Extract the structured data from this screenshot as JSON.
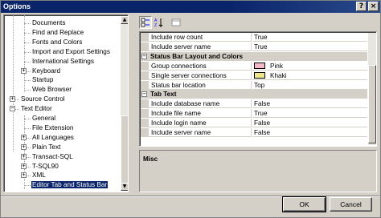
{
  "window": {
    "title": "Options",
    "help_label": "?",
    "close_label": "×"
  },
  "tree": {
    "items": [
      {
        "label": "Documents",
        "level": 2
      },
      {
        "label": "Find and Replace",
        "level": 2
      },
      {
        "label": "Fonts and Colors",
        "level": 2
      },
      {
        "label": "Import and Export Settings",
        "level": 2
      },
      {
        "label": "International Settings",
        "level": 2
      },
      {
        "label": "Keyboard",
        "level": 2,
        "expander": "+"
      },
      {
        "label": "Startup",
        "level": 2
      },
      {
        "label": "Web Browser",
        "level": 2
      },
      {
        "label": "Source Control",
        "level": 1,
        "expander": "+"
      },
      {
        "label": "Text Editor",
        "level": 1,
        "expander": "−"
      },
      {
        "label": "General",
        "level": 2
      },
      {
        "label": "File Extension",
        "level": 2
      },
      {
        "label": "All Languages",
        "level": 2,
        "expander": "+"
      },
      {
        "label": "Plain Text",
        "level": 2,
        "expander": "+"
      },
      {
        "label": "Transact-SQL",
        "level": 2,
        "expander": "+"
      },
      {
        "label": "T-SQL90",
        "level": 2,
        "expander": "+"
      },
      {
        "label": "XML",
        "level": 2,
        "expander": "+"
      },
      {
        "label": "Editor Tab and Status Bar",
        "level": 2,
        "selected": true
      }
    ],
    "scroll_up": "▲",
    "scroll_down": "▼"
  },
  "toolbar": {
    "categorized_icon": "categorized-icon",
    "alphabetical_icon": "alphabetical-icon",
    "property_pages_icon": "property-pages-icon"
  },
  "grid": {
    "rows": [
      {
        "type": "prop",
        "name": "Include row count",
        "value": "True"
      },
      {
        "type": "prop",
        "name": "Include server name",
        "value": "True"
      },
      {
        "type": "cat",
        "name": "Status Bar Layout and Colors",
        "expander": "−"
      },
      {
        "type": "prop",
        "name": "Group connections",
        "value": "Pink",
        "swatch": "#f4b8c8"
      },
      {
        "type": "prop",
        "name": "Single server connections",
        "value": "Khaki",
        "swatch": "#f0e68c"
      },
      {
        "type": "prop",
        "name": "Status bar location",
        "value": "Top"
      },
      {
        "type": "cat",
        "name": "Tab Text",
        "expander": "−"
      },
      {
        "type": "prop",
        "name": "Include database name",
        "value": "False"
      },
      {
        "type": "prop",
        "name": "Include file name",
        "value": "True"
      },
      {
        "type": "prop",
        "name": "Include login name",
        "value": "False"
      },
      {
        "type": "prop",
        "name": "Include server name",
        "value": "False"
      }
    ]
  },
  "description": {
    "title": "Misc"
  },
  "buttons": {
    "ok": "OK",
    "cancel": "Cancel"
  },
  "colors": {
    "titlebar": "#0a246a",
    "selection": "#0a246a",
    "face": "#d4d0c8"
  }
}
